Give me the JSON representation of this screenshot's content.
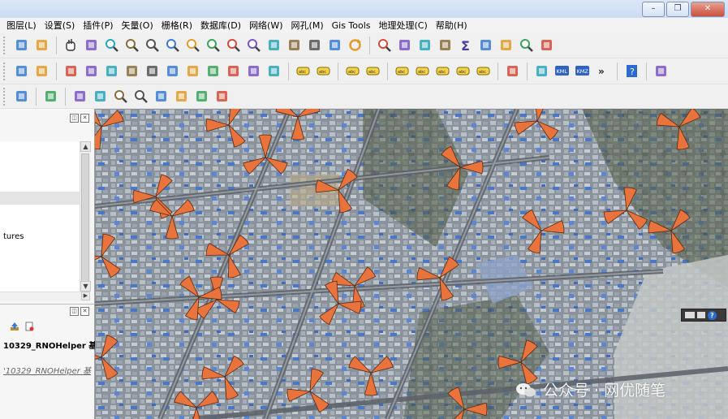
{
  "window": {
    "minimize": "–",
    "restore": "❐",
    "close": "✕"
  },
  "menu": [
    {
      "label": "图层(L)",
      "name": "menu-layer"
    },
    {
      "label": "设置(S)",
      "name": "menu-settings"
    },
    {
      "label": "插件(P)",
      "name": "menu-plugins"
    },
    {
      "label": "矢量(O)",
      "name": "menu-vector"
    },
    {
      "label": "栅格(R)",
      "name": "menu-raster"
    },
    {
      "label": "数据库(D)",
      "name": "menu-database"
    },
    {
      "label": "网络(W)",
      "name": "menu-web"
    },
    {
      "label": "网孔(M)",
      "name": "menu-mesh"
    },
    {
      "label": "Gis Tools",
      "name": "menu-gis-tools"
    },
    {
      "label": "地理处理(C)",
      "name": "menu-processing"
    },
    {
      "label": "帮助(H)",
      "name": "menu-help"
    }
  ],
  "toolbars": {
    "row1": [
      "new-layer-icon",
      "style-manager-icon",
      "|",
      "pan-hand-icon",
      "pan-to-selection-icon",
      "zoom-in-icon",
      "zoom-out-icon",
      "zoom-full-icon",
      "zoom-selection-icon",
      "zoom-layer-icon",
      "zoom-native-icon",
      "zoom-last-icon",
      "zoom-next-icon",
      "new-map-view-icon",
      "new-bookmark-icon",
      "show-bookmarks-icon",
      "temporal-controller-icon",
      "refresh-icon",
      "|",
      "identify-icon",
      "attribute-table-icon",
      "field-calculator-icon",
      "statistics-icon",
      "sum-icon",
      "measure-icon",
      "map-tips-icon",
      "search-icon",
      "text-annotation-icon"
    ],
    "row2": [
      "digitize-icon",
      "toggle-editing-icon",
      "|",
      "edit-pencil-icon",
      "save-edits-icon",
      "add-feature-icon",
      "vertex-tool-icon",
      "modify-attributes-icon",
      "delete-selected-icon",
      "cut-features-icon",
      "copy-features-icon",
      "paste-features-icon",
      "undo-icon",
      "redo-icon",
      "|",
      "label-tool-icon",
      "layer-labeling-icon",
      "|",
      "diagram-icon",
      "label-pin-icon",
      "|",
      "show-hide-labels-icon",
      "preview-labels-icon",
      "move-label-icon",
      "rotate-label-icon",
      "change-label-icon",
      "|",
      "globe-plugin-icon",
      "|",
      "python-console-icon",
      "kml-export-icon",
      "kmz-export-icon",
      "overflow-icon",
      "|",
      "help-contents-icon",
      "|",
      "qgis-plugin-icon"
    ],
    "row3": [
      "cursor-tool-icon",
      "|",
      "cube-layers-icon",
      "|",
      "open-selection-icon",
      "select-feature-icon",
      "zoom-in-tool-icon",
      "zoom-fit-tool-icon",
      "select-rect-icon",
      "network-icon",
      "xy-coordinate-icon",
      "wrench-icon"
    ]
  },
  "left_panel": {
    "layer_text": "tures",
    "plugin_title": "10329_RNOHelper  基",
    "plugin_link": "'10329_RNOHelper  基"
  },
  "watermark": {
    "text": "公众号 · 网优随笔"
  },
  "colors": {
    "sector_fill": "#e8733d",
    "sector_stroke": "#5a2a10",
    "map_base": "#7d8791"
  }
}
